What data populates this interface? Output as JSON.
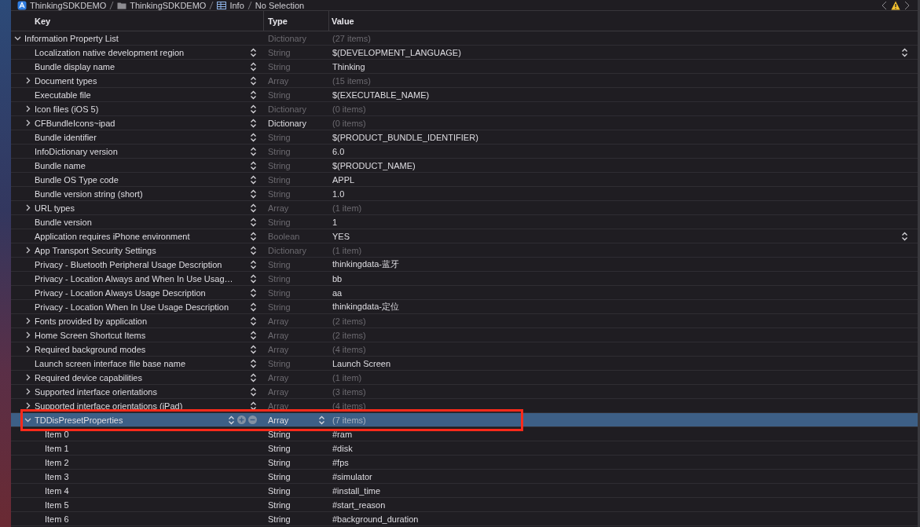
{
  "breadcrumb": [
    {
      "kind": "app",
      "label": "ThinkingSDKDEMO"
    },
    {
      "kind": "folder",
      "label": "ThinkingSDKDEMO"
    },
    {
      "kind": "plist",
      "label": "Info"
    },
    {
      "kind": "text",
      "label": "No Selection"
    }
  ],
  "columns": [
    "Key",
    "Type",
    "Value"
  ],
  "root": {
    "key": "Information Property List",
    "type": "Dictionary",
    "type_greyed": true,
    "value": "(27 items)",
    "value_greyed": true,
    "expanded": true,
    "stepper": false,
    "popup": false,
    "selected": false,
    "children": [
      {
        "key": "Localization native development region",
        "type": "String",
        "type_greyed": true,
        "value": "$(DEVELOPMENT_LANGUAGE)",
        "value_greyed": false,
        "stepper": true,
        "popup": true,
        "selected": false
      },
      {
        "key": "Bundle display name",
        "type": "String",
        "type_greyed": true,
        "value": "Thinking",
        "value_greyed": false,
        "stepper": true,
        "popup": false,
        "selected": false
      },
      {
        "key": "Document types",
        "type": "Array",
        "type_greyed": true,
        "value": "(15 items)",
        "value_greyed": true,
        "expanded": false,
        "stepper": true,
        "popup": false,
        "selected": false
      },
      {
        "key": "Executable file",
        "type": "String",
        "type_greyed": true,
        "value": "$(EXECUTABLE_NAME)",
        "value_greyed": false,
        "stepper": true,
        "popup": false,
        "selected": false
      },
      {
        "key": "Icon files (iOS 5)",
        "type": "Dictionary",
        "type_greyed": true,
        "value": "(0 items)",
        "value_greyed": true,
        "expanded": false,
        "stepper": true,
        "popup": false,
        "selected": false
      },
      {
        "key": "CFBundleIcons~ipad",
        "type": "Dictionary",
        "type_greyed": false,
        "value": "(0 items)",
        "value_greyed": true,
        "expanded": false,
        "stepper": true,
        "popup": false,
        "selected": false
      },
      {
        "key": "Bundle identifier",
        "type": "String",
        "type_greyed": true,
        "value": "$(PRODUCT_BUNDLE_IDENTIFIER)",
        "value_greyed": false,
        "stepper": true,
        "popup": false,
        "selected": false
      },
      {
        "key": "InfoDictionary version",
        "type": "String",
        "type_greyed": true,
        "value": "6.0",
        "value_greyed": false,
        "stepper": true,
        "popup": false,
        "selected": false
      },
      {
        "key": "Bundle name",
        "type": "String",
        "type_greyed": true,
        "value": "$(PRODUCT_NAME)",
        "value_greyed": false,
        "stepper": true,
        "popup": false,
        "selected": false
      },
      {
        "key": "Bundle OS Type code",
        "type": "String",
        "type_greyed": true,
        "value": "APPL",
        "value_greyed": false,
        "stepper": true,
        "popup": false,
        "selected": false
      },
      {
        "key": "Bundle version string (short)",
        "type": "String",
        "type_greyed": true,
        "value": "1.0",
        "value_greyed": false,
        "stepper": true,
        "popup": false,
        "selected": false
      },
      {
        "key": "URL types",
        "type": "Array",
        "type_greyed": true,
        "value": "(1 item)",
        "value_greyed": true,
        "expanded": false,
        "stepper": true,
        "popup": false,
        "selected": false
      },
      {
        "key": "Bundle version",
        "type": "String",
        "type_greyed": true,
        "value": "1",
        "value_greyed": false,
        "stepper": true,
        "popup": false,
        "selected": false
      },
      {
        "key": "Application requires iPhone environment",
        "type": "Boolean",
        "type_greyed": true,
        "value": "YES",
        "value_greyed": false,
        "stepper": true,
        "popup": true,
        "selected": false
      },
      {
        "key": "App Transport Security Settings",
        "type": "Dictionary",
        "type_greyed": true,
        "value": "(1 item)",
        "value_greyed": true,
        "expanded": false,
        "stepper": true,
        "popup": false,
        "selected": false
      },
      {
        "key": "Privacy - Bluetooth Peripheral Usage Description",
        "type": "String",
        "type_greyed": true,
        "value": "thinkingdata-蓝牙",
        "value_greyed": false,
        "stepper": true,
        "popup": false,
        "selected": false
      },
      {
        "key": "Privacy - Location Always and When In Use Usag…",
        "type": "String",
        "type_greyed": true,
        "value": "bb",
        "value_greyed": false,
        "stepper": true,
        "popup": false,
        "selected": false
      },
      {
        "key": "Privacy - Location Always Usage Description",
        "type": "String",
        "type_greyed": true,
        "value": "aa",
        "value_greyed": false,
        "stepper": true,
        "popup": false,
        "selected": false
      },
      {
        "key": "Privacy - Location When In Use Usage Description",
        "type": "String",
        "type_greyed": true,
        "value": "thinkingdata-定位",
        "value_greyed": false,
        "stepper": true,
        "popup": false,
        "selected": false
      },
      {
        "key": "Fonts provided by application",
        "type": "Array",
        "type_greyed": true,
        "value": "(2 items)",
        "value_greyed": true,
        "expanded": false,
        "stepper": true,
        "popup": false,
        "selected": false
      },
      {
        "key": "Home Screen Shortcut Items",
        "type": "Array",
        "type_greyed": true,
        "value": "(2 items)",
        "value_greyed": true,
        "expanded": false,
        "stepper": true,
        "popup": false,
        "selected": false
      },
      {
        "key": "Required background modes",
        "type": "Array",
        "type_greyed": true,
        "value": "(4 items)",
        "value_greyed": true,
        "expanded": false,
        "stepper": true,
        "popup": false,
        "selected": false
      },
      {
        "key": "Launch screen interface file base name",
        "type": "String",
        "type_greyed": true,
        "value": "Launch Screen",
        "value_greyed": false,
        "stepper": true,
        "popup": false,
        "selected": false
      },
      {
        "key": "Required device capabilities",
        "type": "Array",
        "type_greyed": true,
        "value": "(1 item)",
        "value_greyed": true,
        "expanded": false,
        "stepper": true,
        "popup": false,
        "selected": false
      },
      {
        "key": "Supported interface orientations",
        "type": "Array",
        "type_greyed": true,
        "value": "(3 items)",
        "value_greyed": true,
        "expanded": false,
        "stepper": true,
        "popup": false,
        "selected": false
      },
      {
        "key": "Supported interface orientations (iPad)",
        "type": "Array",
        "type_greyed": true,
        "value": "(4 items)",
        "value_greyed": true,
        "expanded": false,
        "stepper": true,
        "popup": false,
        "selected": false
      },
      {
        "key": "TDDisPresetProperties",
        "type": "Array",
        "type_greyed": false,
        "value": "(7 items)",
        "value_greyed": true,
        "expanded": true,
        "stepper": true,
        "popup": false,
        "selected": true,
        "annotated": true,
        "children": [
          {
            "key": "Item 0",
            "type": "String",
            "type_greyed": false,
            "value": "#ram",
            "value_greyed": false,
            "stepper": false,
            "popup": false,
            "selected": false
          },
          {
            "key": "Item 1",
            "type": "String",
            "type_greyed": false,
            "value": "#disk",
            "value_greyed": false,
            "stepper": false,
            "popup": false,
            "selected": false
          },
          {
            "key": "Item 2",
            "type": "String",
            "type_greyed": false,
            "value": "#fps",
            "value_greyed": false,
            "stepper": false,
            "popup": false,
            "selected": false
          },
          {
            "key": "Item 3",
            "type": "String",
            "type_greyed": false,
            "value": "#simulator",
            "value_greyed": false,
            "stepper": false,
            "popup": false,
            "selected": false
          },
          {
            "key": "Item 4",
            "type": "String",
            "type_greyed": false,
            "value": "#install_time",
            "value_greyed": false,
            "stepper": false,
            "popup": false,
            "selected": false
          },
          {
            "key": "Item 5",
            "type": "String",
            "type_greyed": false,
            "value": "#start_reason",
            "value_greyed": false,
            "stepper": false,
            "popup": false,
            "selected": false
          },
          {
            "key": "Item 6",
            "type": "String",
            "type_greyed": false,
            "value": "#background_duration",
            "value_greyed": false,
            "stepper": false,
            "popup": false,
            "selected": false
          }
        ]
      }
    ]
  }
}
